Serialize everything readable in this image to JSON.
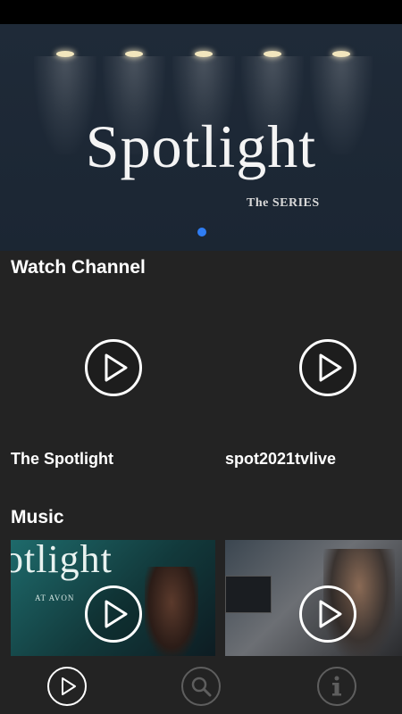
{
  "hero": {
    "title": "Spotlight",
    "subtitle": "The SERIES"
  },
  "sections": {
    "watch": {
      "title": "Watch Channel",
      "items": [
        {
          "label": "The Spotlight"
        },
        {
          "label": "spot2021tvlive"
        }
      ]
    },
    "music": {
      "title": "Music",
      "thumb1_text": "otlight",
      "thumb1_subtext": "AT AVON"
    }
  },
  "tabs": [
    {
      "icon": "play-icon"
    },
    {
      "icon": "search-icon"
    },
    {
      "icon": "info-icon"
    }
  ],
  "colors": {
    "background": "#232323",
    "accent": "#2f7df4"
  }
}
